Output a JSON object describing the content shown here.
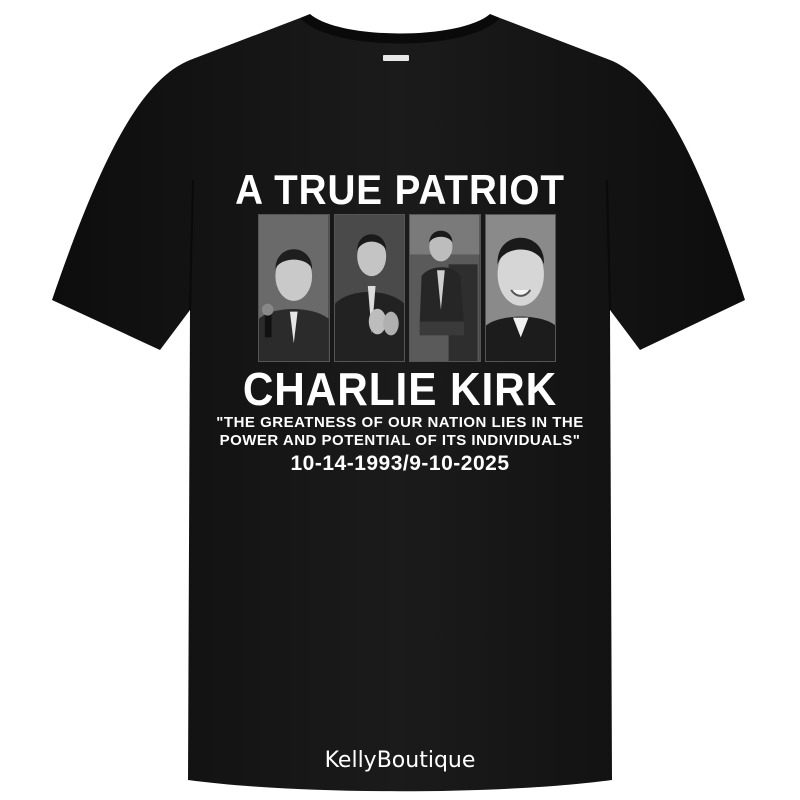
{
  "print": {
    "title": "A TRUE PATRIOT",
    "name": "CHARLIE KIRK",
    "quote_line1": "\"THE GREATNESS OF OUR NATION LIES IN THE",
    "quote_line2": "POWER AND POTENTIAL OF ITS INDIVIDUALS\"",
    "dates": "10-14-1993/9-10-2025"
  },
  "photos": [
    {
      "subject": "man-with-microphone"
    },
    {
      "subject": "man-clapping"
    },
    {
      "subject": "man-seated"
    },
    {
      "subject": "man-smiling-portrait"
    }
  ],
  "brand": "KellyBoutique",
  "colors": {
    "shirt": "#151515",
    "text": "#ffffff",
    "background": "#ffffff"
  }
}
